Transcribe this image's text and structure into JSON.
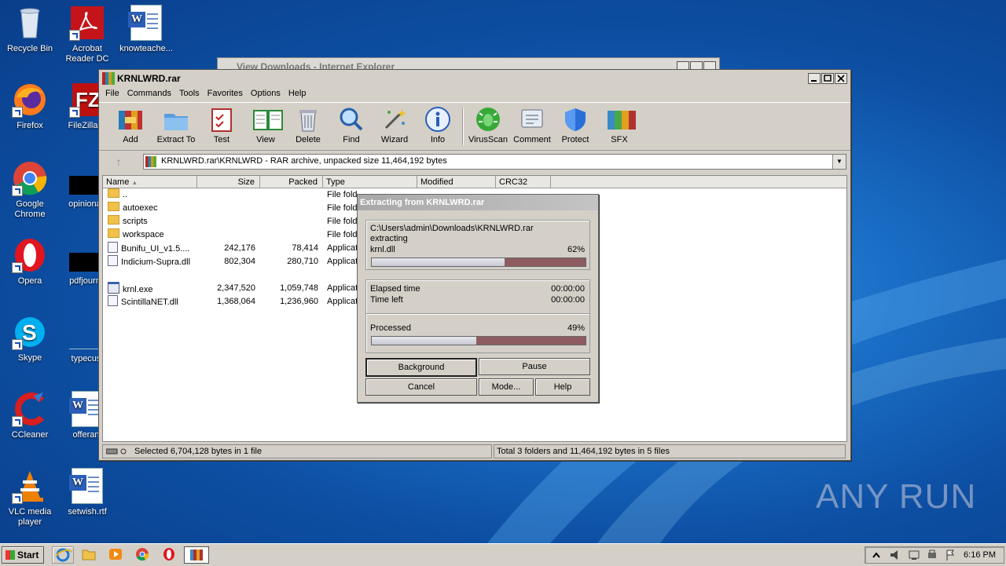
{
  "desktop": {
    "icons": [
      {
        "label": "Recycle Bin"
      },
      {
        "label": "Acrobat Reader DC"
      },
      {
        "label": "knowteache..."
      },
      {
        "label": "Firefox"
      },
      {
        "label": "FileZilla C"
      },
      {
        "label": "Google Chrome"
      },
      {
        "label": "opinionau"
      },
      {
        "label": "Opera"
      },
      {
        "label": "pdfjourna"
      },
      {
        "label": "Skype"
      },
      {
        "label": "typecust"
      },
      {
        "label": "CCleaner"
      },
      {
        "label": "offerant"
      },
      {
        "label": "VLC media player"
      },
      {
        "label": "setwish.rtf"
      }
    ]
  },
  "ie_window": {
    "title": "View Downloads - Internet Explorer"
  },
  "rar": {
    "title": "KRNLWRD.rar",
    "menu": [
      "File",
      "Commands",
      "Tools",
      "Favorites",
      "Options",
      "Help"
    ],
    "toolbar": [
      "Add",
      "Extract To",
      "Test",
      "View",
      "Delete",
      "Find",
      "Wizard",
      "Info",
      "VirusScan",
      "Comment",
      "Protect",
      "SFX"
    ],
    "address": "KRNLWRD.rar\\KRNLWRD - RAR archive, unpacked size 11,464,192 bytes",
    "columns": [
      "Name",
      "Size",
      "Packed",
      "Type",
      "Modified",
      "CRC32"
    ],
    "files": [
      {
        "name": "..",
        "size": "",
        "packed": "",
        "type": "File fold",
        "icon": "folder"
      },
      {
        "name": "autoexec",
        "size": "",
        "packed": "",
        "type": "File fold",
        "icon": "folder"
      },
      {
        "name": "scripts",
        "size": "",
        "packed": "",
        "type": "File fold",
        "icon": "folder"
      },
      {
        "name": "workspace",
        "size": "",
        "packed": "",
        "type": "File fold",
        "icon": "folder"
      },
      {
        "name": "Bunifu_UI_v1.5....",
        "size": "242,176",
        "packed": "78,414",
        "type": "Applicat",
        "icon": "dll"
      },
      {
        "name": "Indicium-Supra.dll",
        "size": "802,304",
        "packed": "280,710",
        "type": "Applicat",
        "icon": "dll"
      },
      {
        "name": "krnl.exe",
        "size": "2,347,520",
        "packed": "1,059,748",
        "type": "Applicat",
        "icon": "exe"
      },
      {
        "name": "ScintillaNET.dll",
        "size": "1,368,064",
        "packed": "1,236,960",
        "type": "Applicat",
        "icon": "dll"
      }
    ],
    "status_left": "Selected 6,704,128 bytes in 1 file",
    "status_right": "Total 3 folders and 11,464,192 bytes in 5 files"
  },
  "extract": {
    "title": "Extracting from KRNLWRD.rar",
    "path": "C:\\Users\\admin\\Downloads\\KRNLWRD.rar",
    "action": "extracting",
    "file": "krnl.dll",
    "file_pct": "62%",
    "file_progress": 0.62,
    "elapsed_label": "Elapsed time",
    "elapsed": "00:00:00",
    "left_label": "Time left",
    "left": "00:00:00",
    "processed_label": "Processed",
    "processed_pct": "49%",
    "processed_progress": 0.49,
    "buttons": {
      "background": "Background",
      "pause": "Pause",
      "cancel": "Cancel",
      "mode": "Mode...",
      "help": "Help"
    }
  },
  "taskbar": {
    "start": "Start",
    "time": "6:16 PM"
  },
  "watermark": "ANY RUN"
}
